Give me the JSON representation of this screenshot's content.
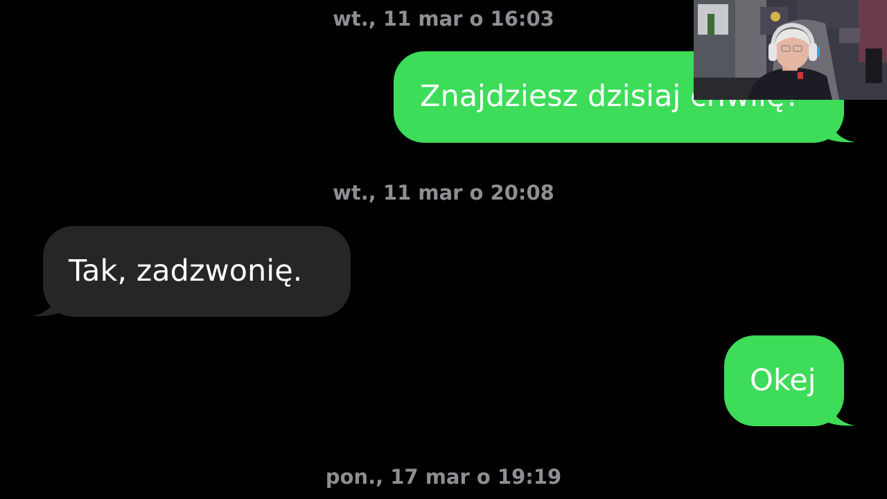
{
  "thread": {
    "timestamps": [
      "wt., 11 mar o 16:03",
      "wt., 11 mar o 20:08",
      "pon., 17 mar o 19:19"
    ],
    "messages": [
      {
        "direction": "sent",
        "text": "Znajdziesz dzisiaj chwilę?"
      },
      {
        "direction": "received",
        "text": "Tak, zadzwonię."
      },
      {
        "direction": "sent",
        "text": "Okej"
      }
    ]
  },
  "colors": {
    "background": "#000000",
    "sent_bubble": "#3ddc59",
    "received_bubble": "#262628",
    "timestamp_text": "#8e8e93"
  },
  "overlay": {
    "webcam": "streamer-webcam-image"
  }
}
